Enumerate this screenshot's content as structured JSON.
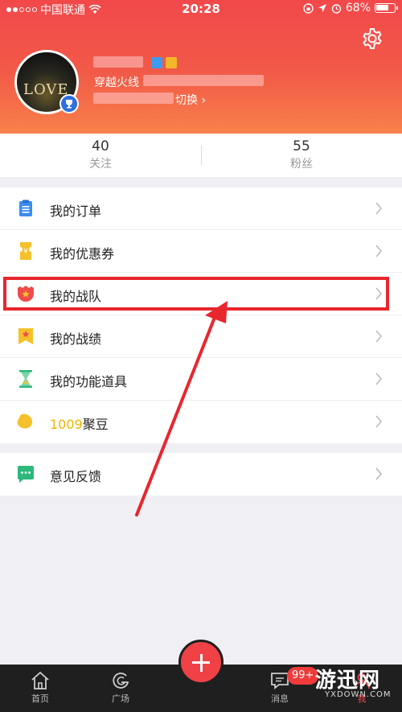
{
  "status_bar": {
    "carrier": "中国联通",
    "time": "20:28",
    "battery": "68%"
  },
  "profile": {
    "nickname": "穿越火线",
    "switch_label": "切换 ›",
    "avatar_text": "LOVE"
  },
  "stats": [
    {
      "value": "40",
      "label": "关注"
    },
    {
      "value": "55",
      "label": "粉丝"
    }
  ],
  "menu_group_1": [
    {
      "label": "我的订单",
      "icon": "clipboard-icon"
    },
    {
      "label": "我的优惠券",
      "icon": "coupon-icon"
    },
    {
      "label": "我的战队",
      "icon": "team-shield-icon"
    },
    {
      "label": "我的战绩",
      "icon": "bookmark-star-icon"
    },
    {
      "label": "我的功能道具",
      "icon": "hourglass-icon"
    },
    {
      "label_number": "1009",
      "label_suffix": "聚豆",
      "icon": "bean-icon"
    }
  ],
  "menu_group_2": [
    {
      "label": "意见反馈",
      "icon": "chat-bubble-icon"
    }
  ],
  "tabbar": {
    "home": "首页",
    "square": "广场",
    "messages": "消息",
    "me": "我",
    "message_badge": "99+"
  },
  "watermark": {
    "main": "游迅网",
    "sub": "YXDOWN.COM"
  },
  "colors": {
    "header_start": "#f2484a",
    "header_end": "#f8814a",
    "accent_red": "#e8262e",
    "gold": "#f0b400"
  }
}
